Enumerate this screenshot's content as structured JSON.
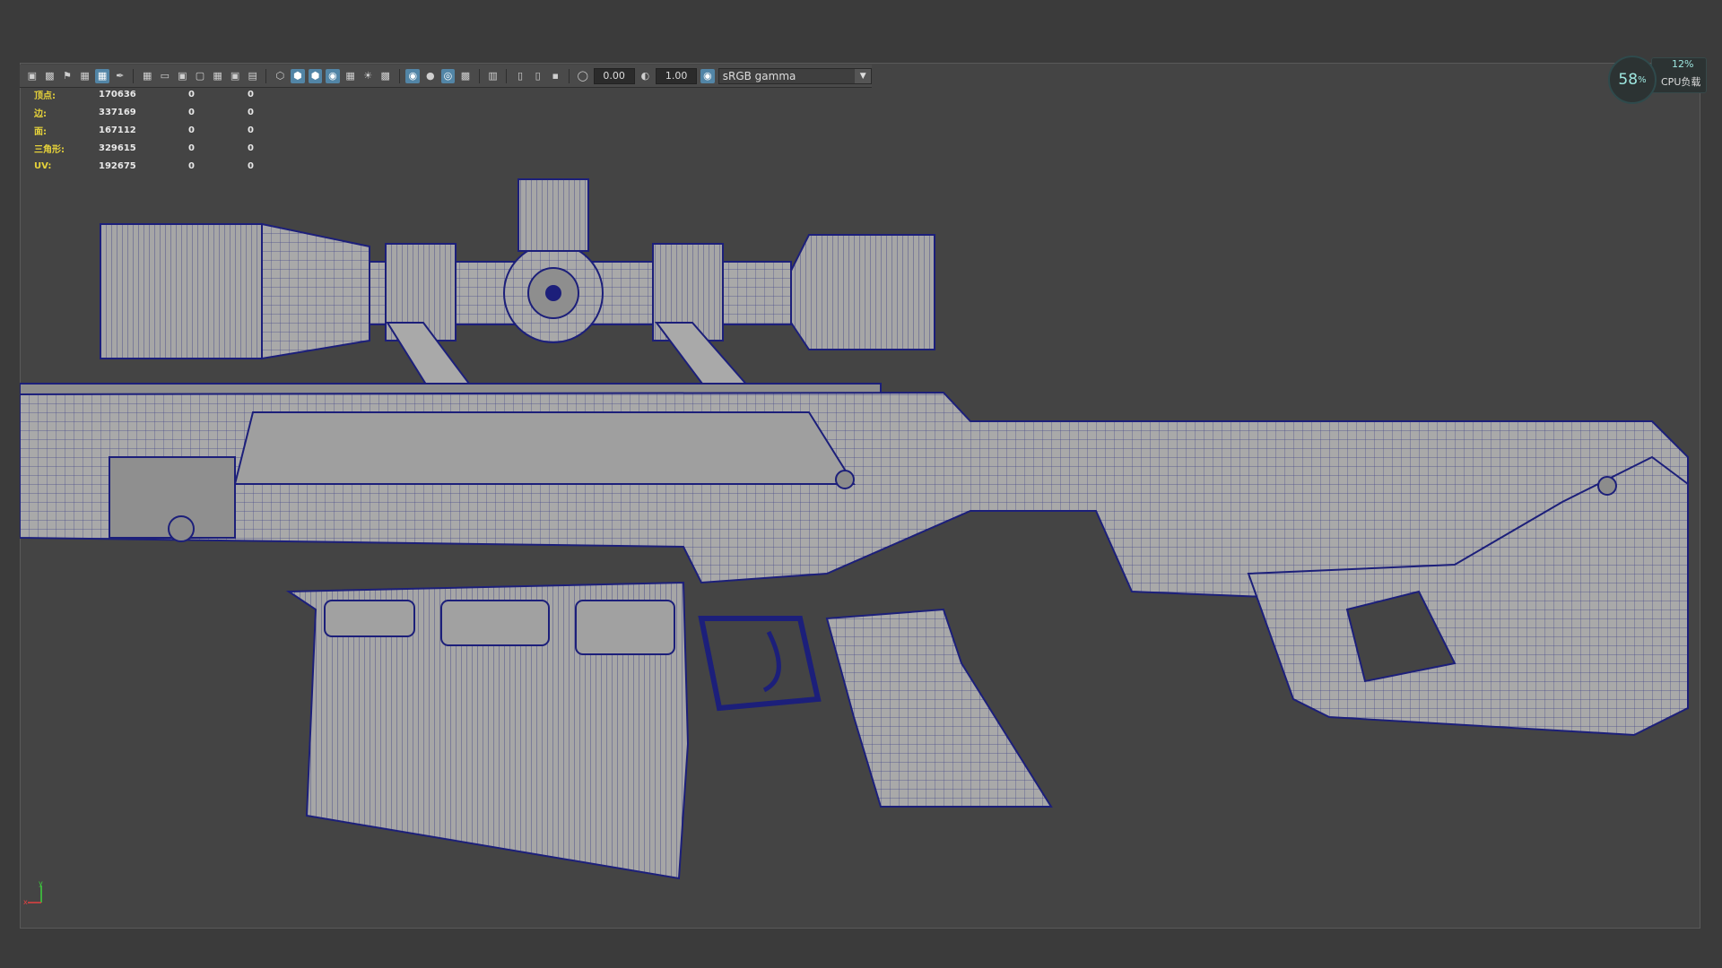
{
  "toolbar": {
    "exposure_value": "0.00",
    "gamma_value": "1.00",
    "color_space": "sRGB gamma"
  },
  "stats": {
    "rows": [
      {
        "label": "顶点:",
        "value": "170636",
        "a": "0",
        "b": "0"
      },
      {
        "label": "边:",
        "value": "337169",
        "a": "0",
        "b": "0"
      },
      {
        "label": "面:",
        "value": "167112",
        "a": "0",
        "b": "0"
      },
      {
        "label": "三角形:",
        "value": "329615",
        "a": "0",
        "b": "0"
      },
      {
        "label": "UV:",
        "value": "192675",
        "a": "0",
        "b": "0"
      }
    ]
  },
  "performance": {
    "memory_percent": "58",
    "percent_sign": "%",
    "cpu_percent": "12%",
    "cpu_label": "CPU负载"
  },
  "axis": {
    "y": "y",
    "x": "x"
  },
  "colors": {
    "viewport_bg": "#444444",
    "wire": "#1c1f7a",
    "surface": "#a9a9a9",
    "hud_label": "#e6d23a"
  }
}
